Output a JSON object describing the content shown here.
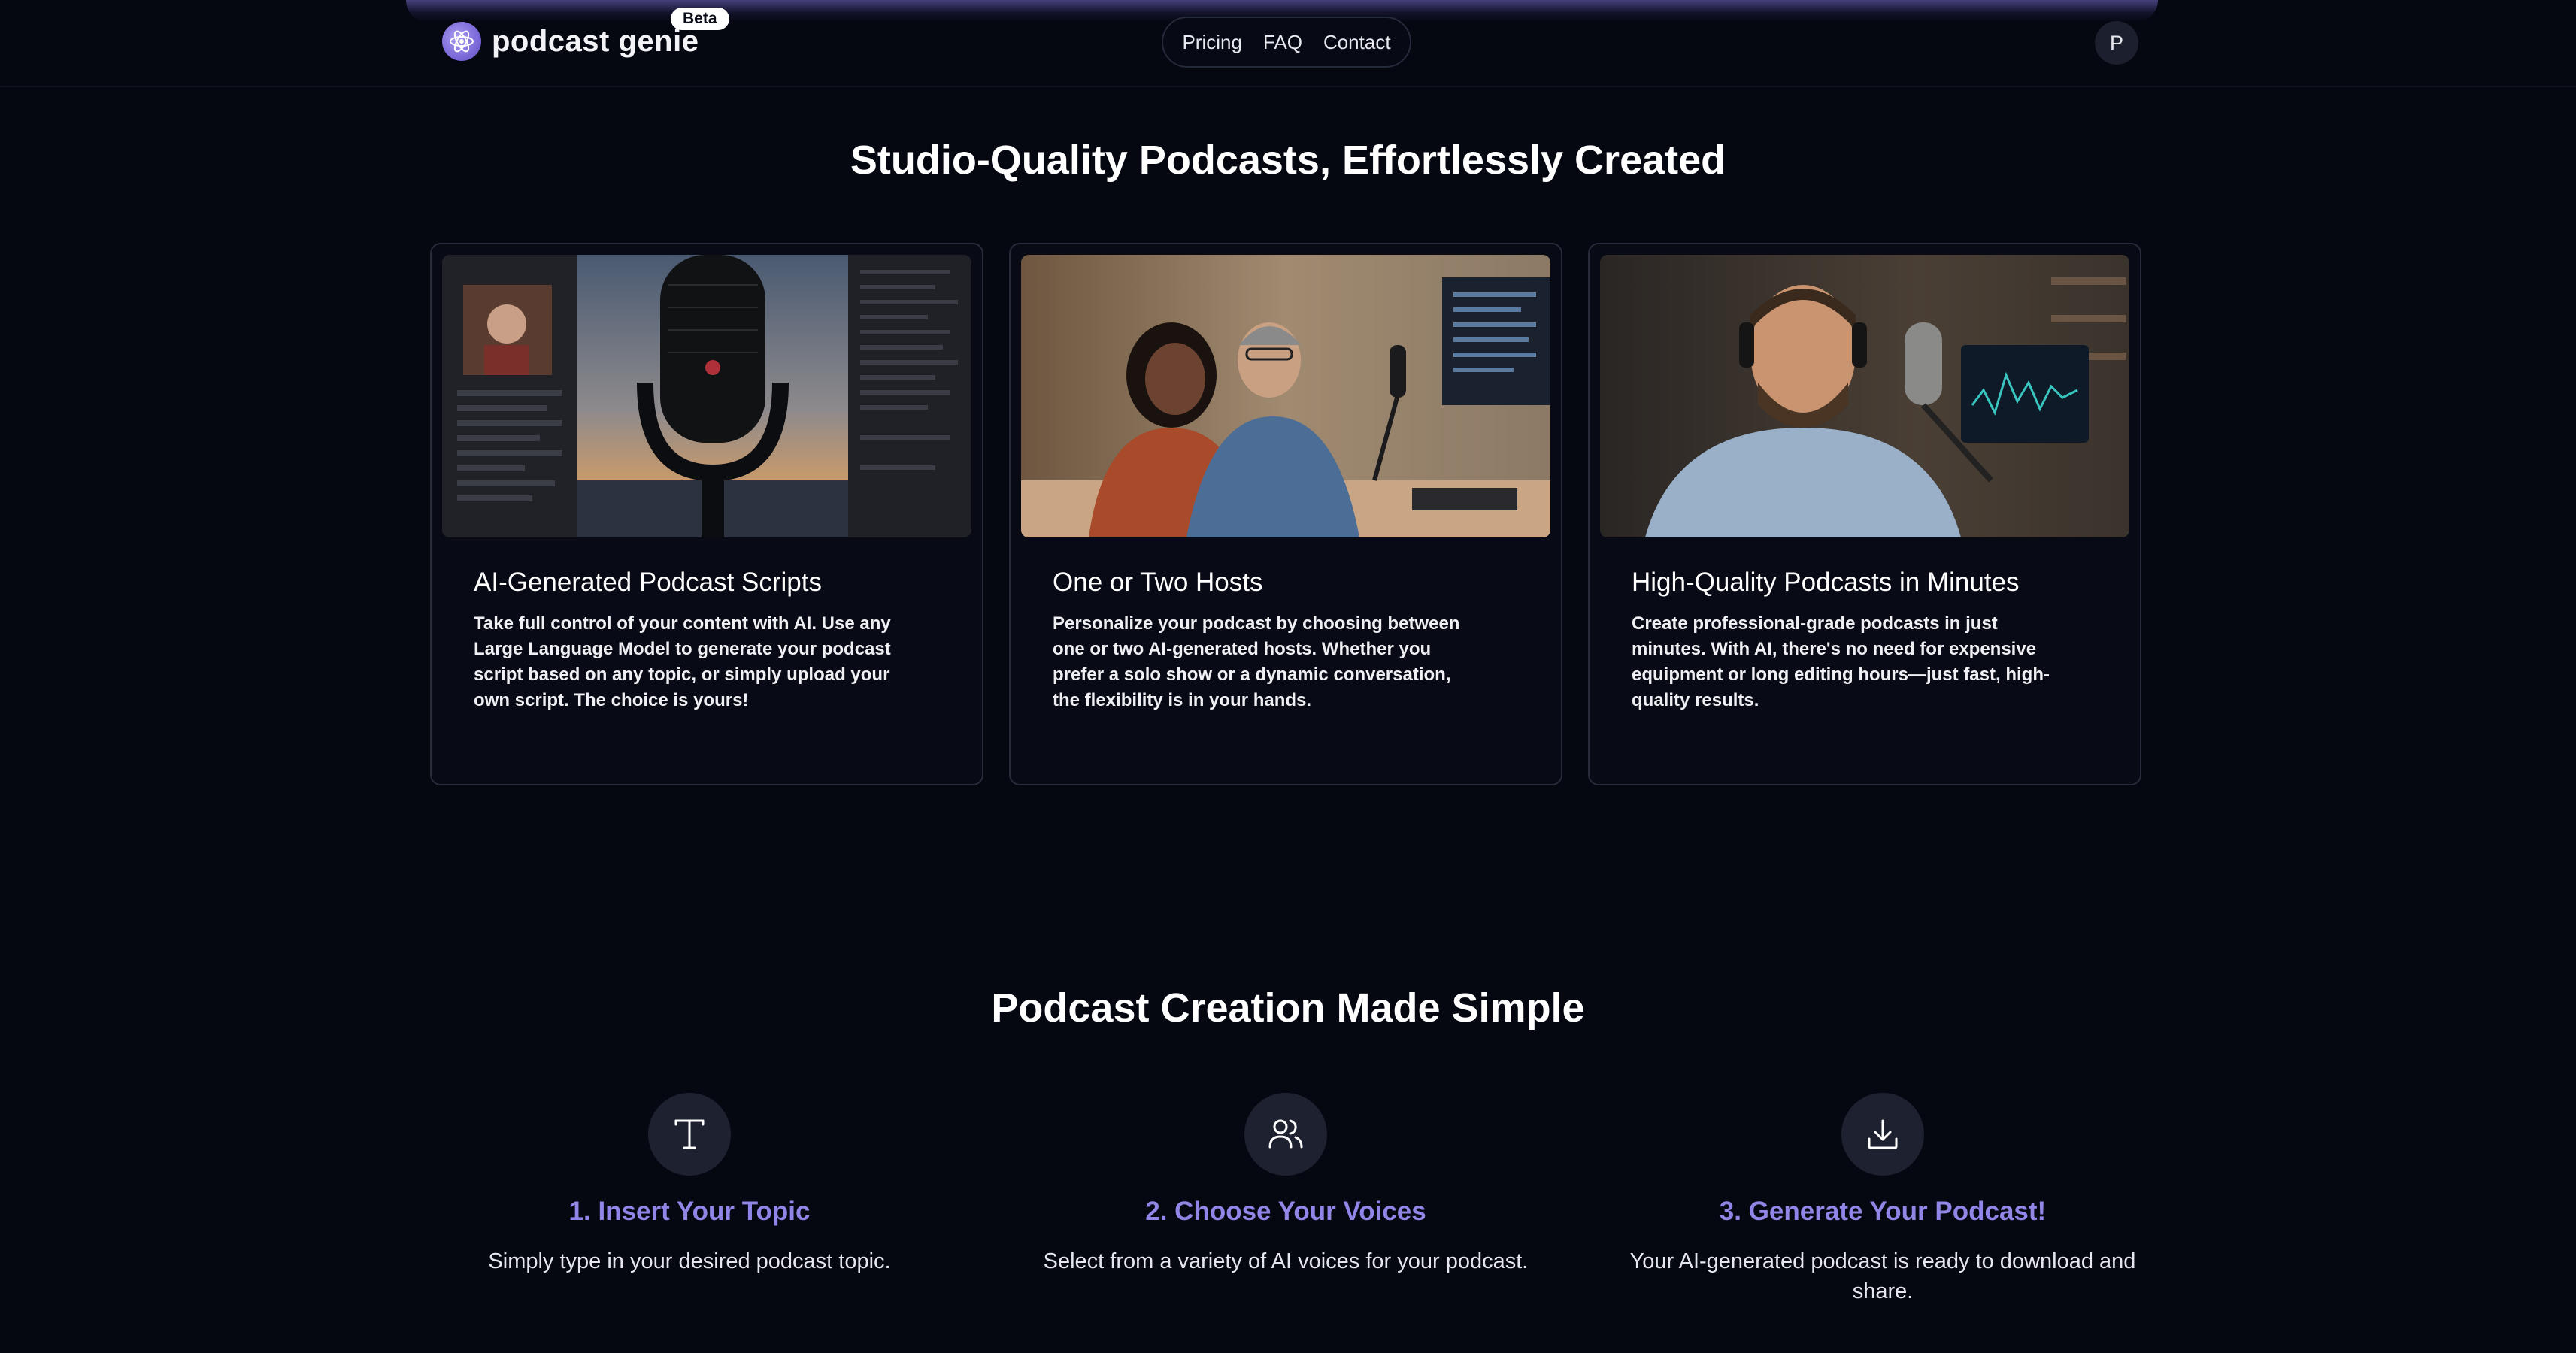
{
  "header": {
    "logo_text": "podcast genie",
    "badge": "Beta",
    "nav": [
      {
        "label": "Pricing"
      },
      {
        "label": "FAQ"
      },
      {
        "label": "Contact"
      }
    ],
    "avatar_initial": "P"
  },
  "features": {
    "title": "Studio-Quality Podcasts, Effortlessly Created",
    "cards": [
      {
        "title": "AI-Generated Podcast Scripts",
        "description": "Take full control of your content with AI. Use any Large Language Model to generate your podcast script based on any topic, or simply upload your own script. The choice is yours!"
      },
      {
        "title": "One or Two Hosts",
        "description": "Personalize your podcast by choosing between one or two AI-generated hosts. Whether you prefer a solo show or a dynamic conversation, the flexibility is in your hands."
      },
      {
        "title": "High-Quality Podcasts in Minutes",
        "description": "Create professional-grade podcasts in just minutes. With AI, there's no need for expensive equipment or long editing hours—just fast, high-quality results."
      }
    ]
  },
  "steps": {
    "title": "Podcast Creation Made Simple",
    "items": [
      {
        "icon": "text-type-icon",
        "title": "1. Insert Your Topic",
        "description": "Simply type in your desired podcast topic."
      },
      {
        "icon": "users-icon",
        "title": "2. Choose Your Voices",
        "description": "Select from a variety of AI voices for your podcast."
      },
      {
        "icon": "download-icon",
        "title": "3. Generate Your Podcast!",
        "description": "Your AI-generated podcast is ready to download and share."
      }
    ]
  },
  "colors": {
    "background": "#050711",
    "accent": "#8f86e8",
    "card_border": "#272b3a"
  }
}
